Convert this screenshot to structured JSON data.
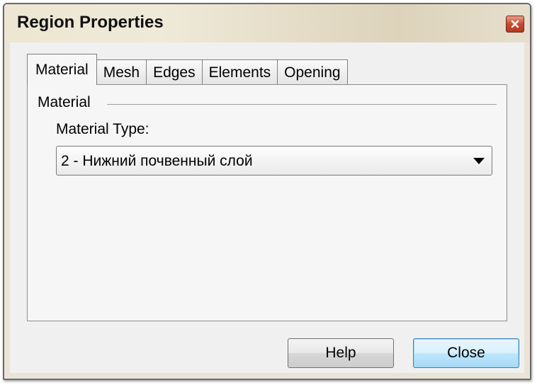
{
  "window": {
    "title": "Region Properties"
  },
  "tabs": [
    {
      "label": "Material",
      "active": true
    },
    {
      "label": "Mesh",
      "active": false
    },
    {
      "label": "Edges",
      "active": false
    },
    {
      "label": "Elements",
      "active": false
    },
    {
      "label": "Opening",
      "active": false
    }
  ],
  "material_group": {
    "label": "Material",
    "material_type_label": "Material Type:",
    "material_type_value": "2 - Нижний почвенный слой"
  },
  "buttons": {
    "help_label": "Help",
    "close_label": "Close"
  },
  "icons": {
    "close": "close-icon",
    "dropdown": "chevron-down-icon"
  },
  "colors": {
    "close_button": "#c74a30",
    "default_button_border": "#3c7fb1"
  }
}
